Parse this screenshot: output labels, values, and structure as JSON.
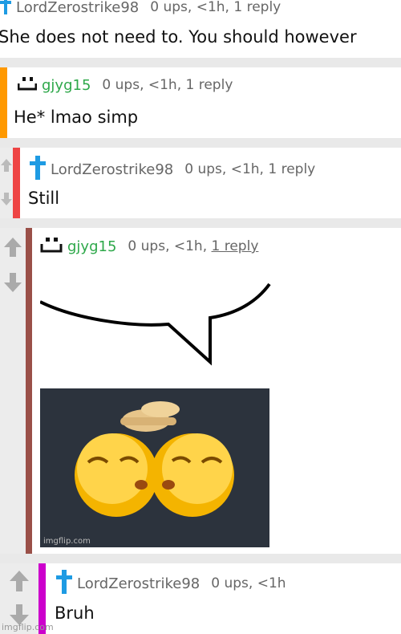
{
  "comments": [
    {
      "username": "LordZerostrike98",
      "meta": "0 ups, <1h, 1 reply",
      "text": "She does not need to. You should however"
    },
    {
      "username": "gjyg15",
      "meta": "0 ups, <1h, 1 reply",
      "text": "He* lmao simp"
    },
    {
      "username": "LordZerostrike98",
      "meta": "0 ups, <1h, 1 reply",
      "text": "Still"
    },
    {
      "username": "gjyg15",
      "meta_prefix": "0 ups, <1h, ",
      "meta_link": "1 reply",
      "text": ""
    },
    {
      "username": "LordZerostrike98",
      "meta": "0 ups, <1h",
      "text": "Bruh"
    }
  ],
  "icons": {
    "zero_user_icon": "cross-icon",
    "one_user_icon": "smiley-face-icon",
    "upvote": "up-arrow-icon",
    "downvote": "down-arrow-icon"
  },
  "colors": {
    "bar_orange": "#ff9900",
    "bar_red": "#ee4444",
    "bar_brown": "#9a5048",
    "bar_magenta": "#cc00cc",
    "username_green": "#2ea84a",
    "cross_blue": "#1e9be3"
  },
  "image_content": {
    "description_icon": "speech-bubble-emoji-image",
    "watermark": "imgflip.com"
  },
  "footer_watermark": "imgflip.com"
}
